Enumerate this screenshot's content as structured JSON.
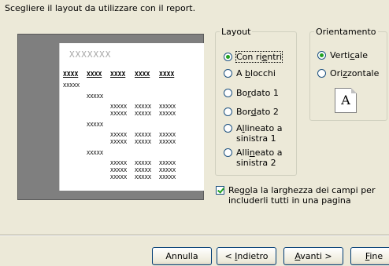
{
  "instruction": "Scegliere il layout da utilizzare con il report.",
  "preview": {
    "title": "XXXXXXX",
    "header_cells": [
      "XXXX",
      "XXXX",
      "XXXX",
      "XXXX",
      "XXXX"
    ],
    "group_cell": "XXXXX",
    "sub_group_cell": "XXXXX",
    "detail_cell": "XXXXX"
  },
  "layout_group": {
    "legend": "Layout",
    "options": [
      {
        "pre": "Con ri",
        "key": "e",
        "post": "ntri",
        "selected": true
      },
      {
        "pre": "A ",
        "key": "b",
        "post": "locchi",
        "selected": false
      },
      {
        "pre": "Bo",
        "key": "r",
        "post": "dato 1",
        "selected": false
      },
      {
        "pre": "Bor",
        "key": "d",
        "post": "ato 2",
        "selected": false
      },
      {
        "pre": "A",
        "key": "l",
        "post": "lineato a",
        "line2": "sinistra 1",
        "selected": false
      },
      {
        "pre": "Alli",
        "key": "n",
        "post": "eato a",
        "line2": "sinistra 2",
        "selected": false
      }
    ]
  },
  "orientation_group": {
    "legend": "Orientamento",
    "options": [
      {
        "pre": "Verti",
        "key": "c",
        "post": "ale",
        "selected": true
      },
      {
        "pre": "Ori",
        "key": "z",
        "post": "zontale",
        "selected": false
      }
    ],
    "page_icon_letter": "A"
  },
  "adjust_checkbox": {
    "pre": "Reg",
    "key": "o",
    "post": "la la larghezza dei campi per includerli tutti in una pagina",
    "checked": true
  },
  "buttons": {
    "cancel": "Annulla",
    "back": {
      "pre": "< ",
      "key": "I",
      "post": "ndietro"
    },
    "next": {
      "pre": "",
      "key": "A",
      "post": "vanti >"
    },
    "finish": {
      "pre": "",
      "key": "F",
      "post": "ine"
    }
  }
}
